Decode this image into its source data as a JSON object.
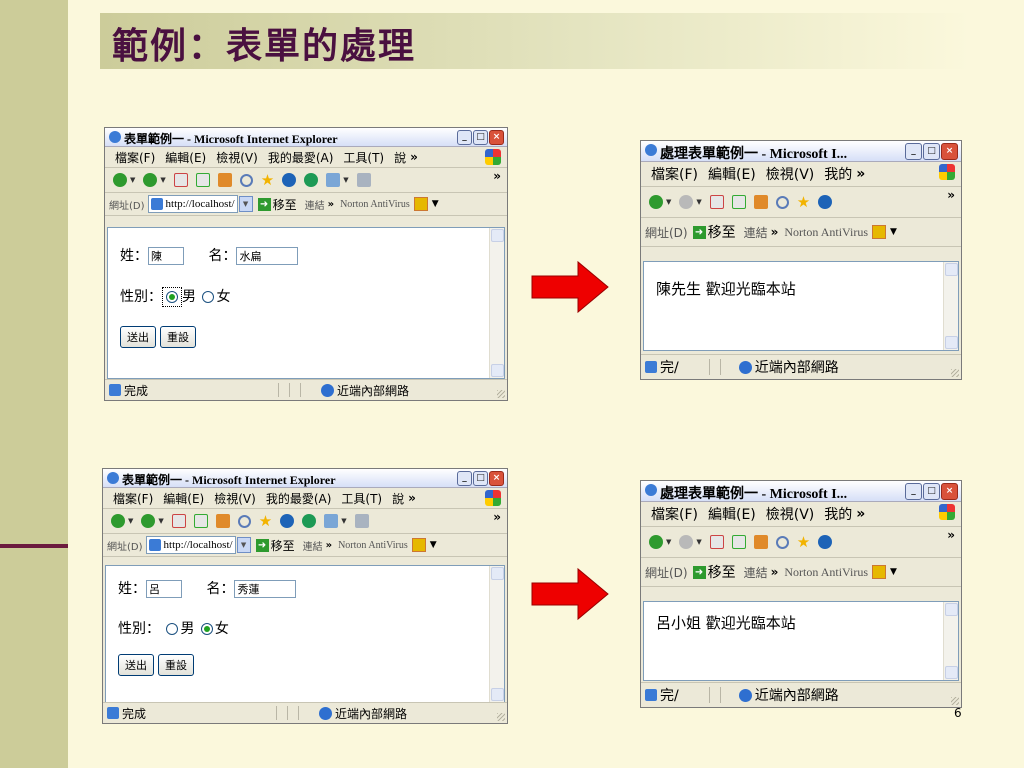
{
  "slide": {
    "title": "範例：表單的處理",
    "page_number": "6"
  },
  "browser_common": {
    "menu": {
      "file": "檔案(F)",
      "edit": "編輯(E)",
      "view": "檢視(V)",
      "favorites": "我的最愛(A)",
      "tools": "工具(T)",
      "help_cut": "說",
      "favorites_cut": "我的",
      "chevron": "»"
    },
    "address_label": "網址(D)",
    "address_value": "http://localhost/",
    "go_label": "移至",
    "links_label": "連結",
    "norton_label": "Norton AntiVirus",
    "zone_label": "近端內部網路"
  },
  "form_windows": [
    {
      "title": "表單範例一 - Microsoft Internet Explorer",
      "surname_label": "姓：",
      "surname_value": "陳",
      "given_label": "名：",
      "given_value": "水扁",
      "gender_label": "性別：",
      "male_label": "男",
      "female_label": "女",
      "selected": "男",
      "submit_label": "送出",
      "reset_label": "重設",
      "status_text": "完成"
    },
    {
      "title": "表單範例一 - Microsoft Internet Explorer",
      "surname_label": "姓：",
      "surname_value": "呂",
      "given_label": "名：",
      "given_value": "秀蓮",
      "gender_label": "性別：",
      "male_label": "男",
      "female_label": "女",
      "selected": "女",
      "submit_label": "送出",
      "reset_label": "重設",
      "status_text": "完成"
    }
  ],
  "result_windows": [
    {
      "title": "處理表單範例一 - Microsoft I...",
      "message": "陳先生 歡迎光臨本站",
      "status_text": "完/"
    },
    {
      "title": "處理表單範例一 - Microsoft I...",
      "message": "呂小姐 歡迎光臨本站",
      "status_text": "完/"
    }
  ],
  "colors": {
    "background": "#fbf8dc",
    "sidebar": "#cccc99",
    "title_text": "#4a1040",
    "arrow_red": "#ee0000"
  }
}
